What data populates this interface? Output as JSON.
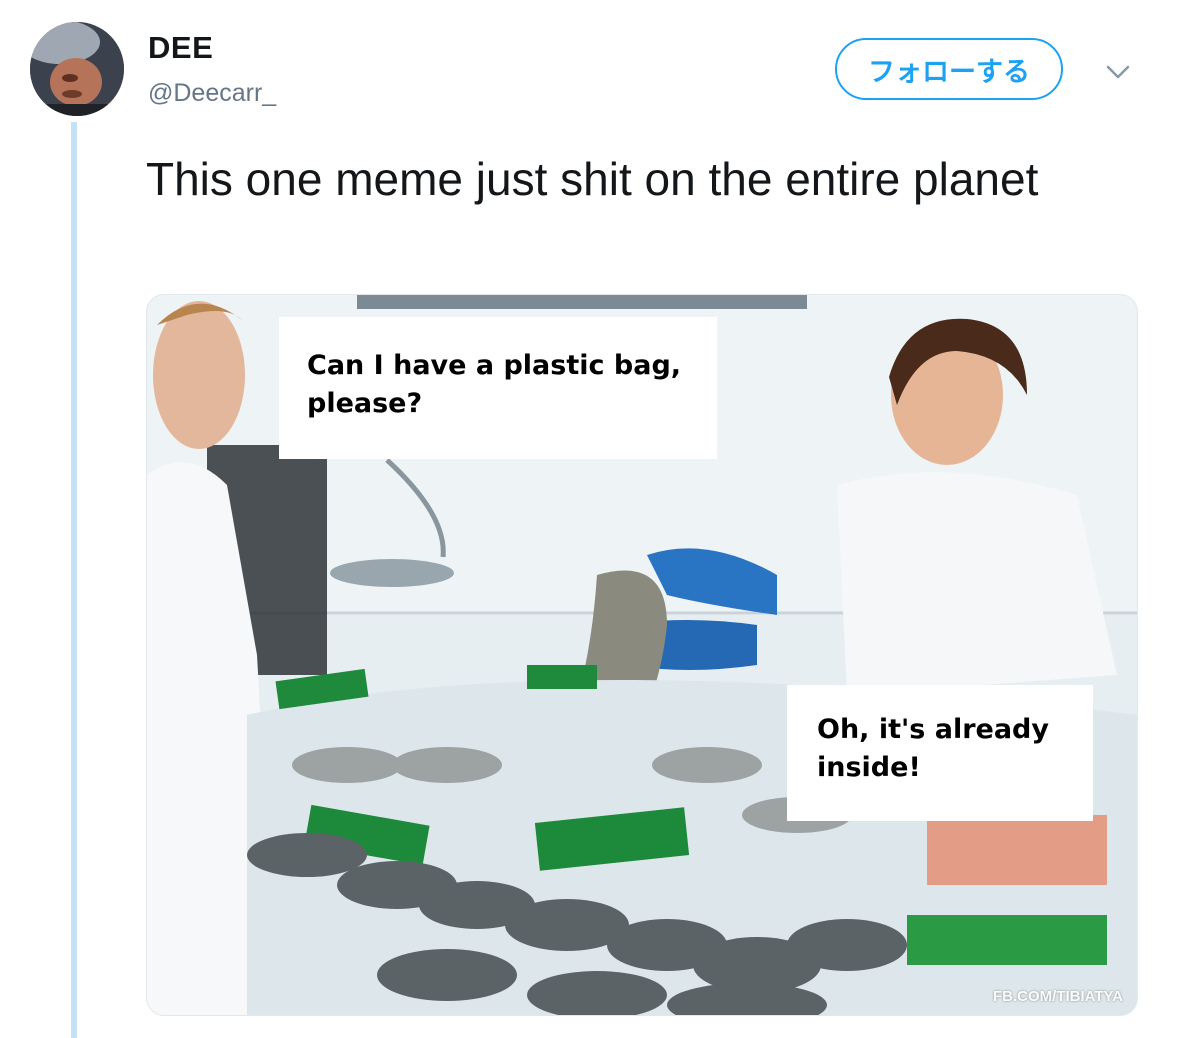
{
  "user": {
    "display_name": "DEE",
    "handle": "@Deecarr_"
  },
  "follow_button": {
    "label": "フォローする"
  },
  "menu": {
    "icon": "chevron-down-icon"
  },
  "tweet": {
    "text": "This one meme just shit on the entire planet"
  },
  "meme": {
    "top_caption": "Can I have a plastic bag, please?",
    "bottom_caption": "Oh, it's already inside!",
    "watermark": "FB.COM/TIBIATYA"
  },
  "colors": {
    "accent": "#1da1f2",
    "thread_line": "#c4e1f6",
    "text": "#14171a",
    "secondary_text": "#657786"
  }
}
